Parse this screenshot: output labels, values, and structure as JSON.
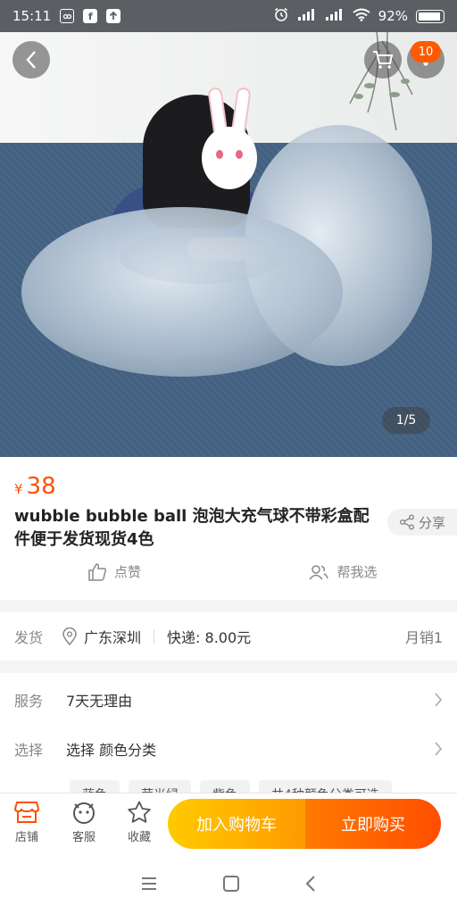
{
  "status_bar": {
    "time": "15:11",
    "battery": "92%",
    "app_icon_f": "f"
  },
  "gallery": {
    "counter": "1/5",
    "cart_badge": "10"
  },
  "product": {
    "currency": "¥",
    "price": "38",
    "title": "wubble bubble ball 泡泡大充气球不带彩盒配件便于发货现货4色",
    "share_label": "分享",
    "like_label": "点赞",
    "help_choose_label": "帮我选"
  },
  "shipping": {
    "label": "发货",
    "location": "广东深圳",
    "express": "快递: 8.00元",
    "monthly_sales": "月销1"
  },
  "service": {
    "label": "服务",
    "value": "7天无理由",
    "select_label": "选择",
    "select_value": "选择 颜色分类",
    "chips": [
      "蓝色",
      "荧光绿",
      "紫色",
      "共4种颜色分类可选"
    ]
  },
  "action_bar": {
    "store": "店铺",
    "customer_service": "客服",
    "favorite": "收藏",
    "add_to_cart": "加入购物车",
    "buy_now": "立即购买"
  },
  "colors": {
    "accent": "#ff5000",
    "cart_button": "#ffb300",
    "buy_button": "#ff5a00"
  }
}
